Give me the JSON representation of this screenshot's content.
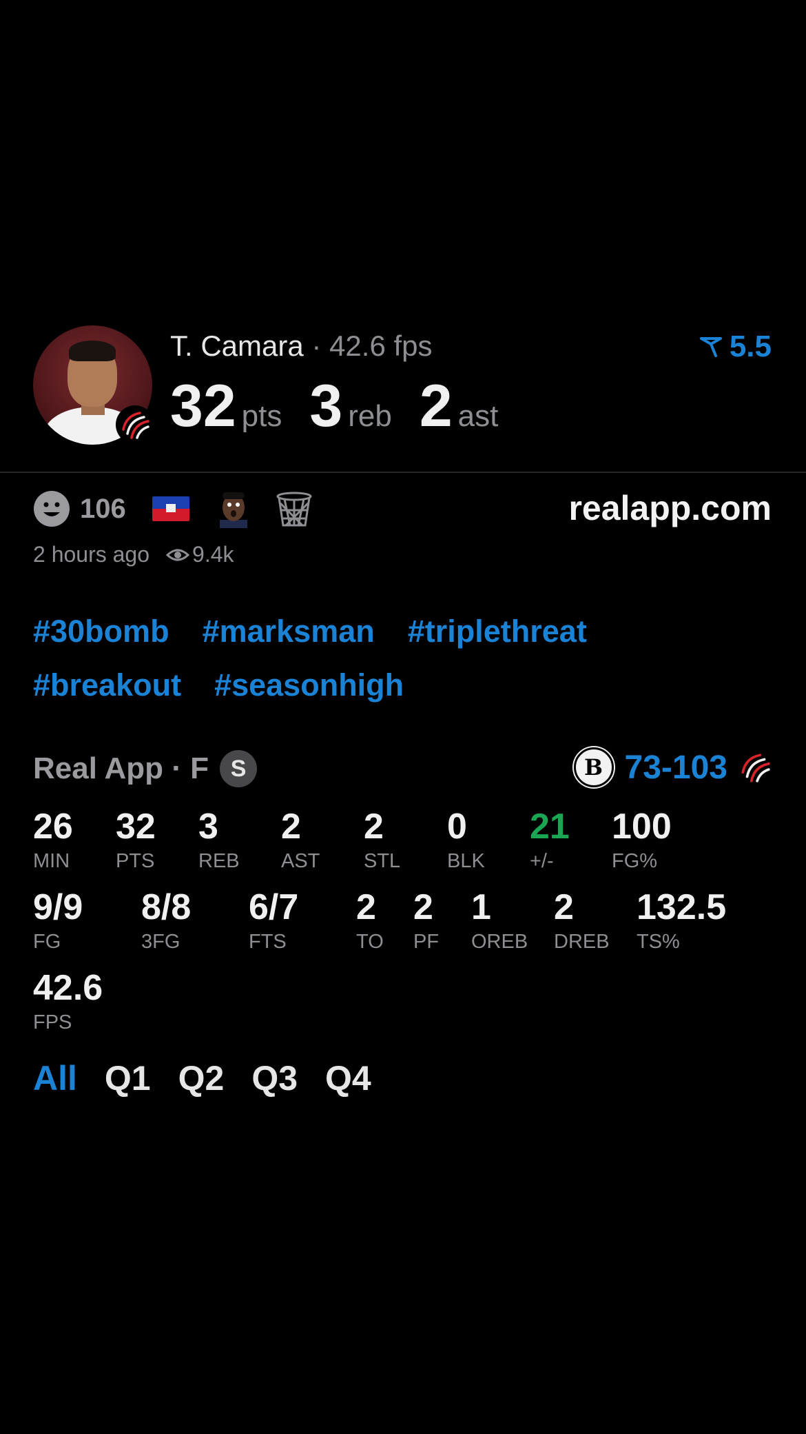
{
  "player": {
    "name": "T. Camara",
    "separator": "·",
    "fps": "42.6 fps",
    "spread": "5.5",
    "pts_value": "32",
    "pts_unit": "pts",
    "reb_value": "3",
    "reb_unit": "reb",
    "ast_value": "2",
    "ast_unit": "ast"
  },
  "reactions": {
    "count": "106",
    "site": "realapp.com",
    "time_ago": "2 hours ago",
    "views": "9.4k"
  },
  "hashtags": {
    "row1": [
      "#30bomb",
      "#marksman",
      "#triplethreat"
    ],
    "row2": [
      "#breakout",
      "#seasonhigh"
    ]
  },
  "game": {
    "label": "Real App · F",
    "status_badge": "S",
    "opponent_logo_letter": "B",
    "score": "73-103"
  },
  "stats": {
    "row1": [
      {
        "value": "26",
        "label": "MIN"
      },
      {
        "value": "32",
        "label": "PTS"
      },
      {
        "value": "3",
        "label": "REB"
      },
      {
        "value": "2",
        "label": "AST"
      },
      {
        "value": "2",
        "label": "STL"
      },
      {
        "value": "0",
        "label": "BLK"
      },
      {
        "value": "21",
        "label": "+/-"
      },
      {
        "value": "100",
        "label": "FG%"
      }
    ],
    "row2": [
      {
        "value": "9/9",
        "label": "FG"
      },
      {
        "value": "8/8",
        "label": "3FG"
      },
      {
        "value": "6/7",
        "label": "FTS"
      },
      {
        "value": "2",
        "label": "TO"
      },
      {
        "value": "2",
        "label": "PF"
      },
      {
        "value": "1",
        "label": "OREB"
      },
      {
        "value": "2",
        "label": "DREB"
      },
      {
        "value": "132.5",
        "label": "TS%"
      }
    ],
    "row3": [
      {
        "value": "42.6",
        "label": "FPS"
      }
    ]
  },
  "quarters": {
    "tabs": [
      "All",
      "Q1",
      "Q2",
      "Q3",
      "Q4"
    ],
    "active": "All"
  },
  "colors": {
    "accent": "#1a83d6",
    "positive": "#1aa653",
    "background": "#000000",
    "muted": "#8e8e93"
  },
  "icons": {
    "spread": "spread-arrow-icon",
    "reaction": "smiley-icon",
    "flag": "haiti-flag-icon",
    "emoji": "shocked-face-icon",
    "hoop": "basketball-hoop-icon",
    "views": "eye-icon",
    "team": "blazers-pinwheel-icon"
  }
}
